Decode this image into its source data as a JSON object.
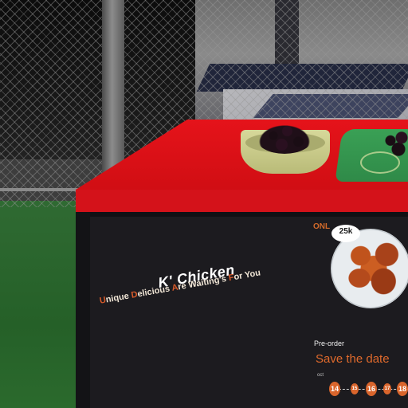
{
  "banner": {
    "brand": "K' Chicken",
    "tagline_parts": [
      {
        "text": "U",
        "highlight": true
      },
      {
        "text": "nique ",
        "highlight": false
      },
      {
        "text": "D",
        "highlight": true
      },
      {
        "text": "elicious ",
        "highlight": false
      },
      {
        "text": "A",
        "highlight": true
      },
      {
        "text": "re Waiting's ",
        "highlight": false
      },
      {
        "text": "F",
        "highlight": true
      },
      {
        "text": "or You",
        "highlight": false
      }
    ],
    "only_label": "ONL",
    "price": "25k",
    "preorder": "Pre-order",
    "save_the_date": "Save the date",
    "tiny_label": "oct",
    "dates": [
      "14",
      "15",
      "16",
      "17",
      "18"
    ]
  },
  "colors": {
    "counter_red": "#e5131a",
    "banner_black": "#1c1b1f",
    "accent_orange": "#d9652c",
    "grass_green": "#2f6a32"
  }
}
